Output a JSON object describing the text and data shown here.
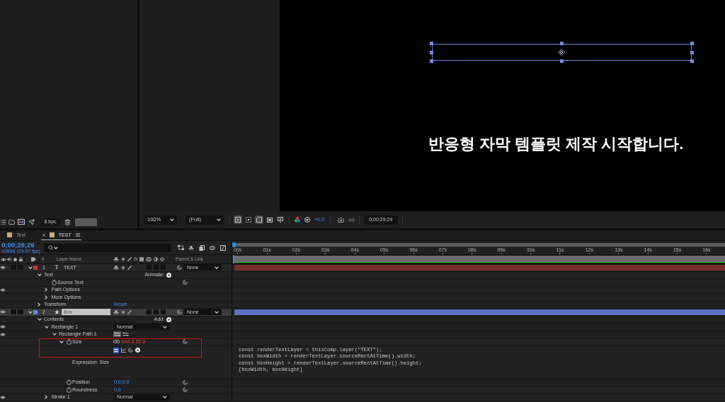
{
  "project_panel": {
    "bit_depth": "8 bpc"
  },
  "viewer": {
    "caption": "반응형 자막 템플릿 제작 시작합니다.",
    "zoom": "100%",
    "resolution": "(Full)",
    "toggles": [
      {
        "kind": "cursor",
        "on": true
      },
      {
        "kind": "grid",
        "on": false
      },
      {
        "kind": "corner",
        "on": true
      },
      {
        "kind": "frame",
        "on": false
      },
      {
        "kind": "screen",
        "on": false
      }
    ],
    "exposure": "+0.0",
    "timecode": "0;00;29;29"
  },
  "timeline": {
    "tabs": [
      {
        "label": "Text",
        "selected": false
      },
      {
        "label": "TEST",
        "selected": true
      }
    ],
    "timecode": "0;00;29;29",
    "frame_info": "00899 (29.97 fps)",
    "columns": {
      "number": "#",
      "layer_name": "Layer Name",
      "effects": "fx",
      "parent": "Parent & Link"
    },
    "ruler": [
      "00s",
      "01s",
      "02s",
      "03s",
      "04s",
      "05s",
      "06s",
      "07s",
      "08s",
      "09s",
      "10s",
      "11s",
      "12s",
      "13s",
      "14s",
      "15s",
      "16s"
    ],
    "layers": [
      {
        "number": "1",
        "kind": "text",
        "type_icon": "T",
        "name": "TEXT",
        "color": "#c23a32",
        "selected": false,
        "visible": true,
        "expanded": true,
        "parent": "None",
        "children": [
          {
            "kind": "group",
            "name": "Text",
            "expanded": true,
            "action": "Animate:",
            "children": [
              {
                "kind": "property",
                "name": "Source Text"
              },
              {
                "kind": "group",
                "name": "Path Options",
                "expanded": false,
                "visible": true
              },
              {
                "kind": "group",
                "name": "More Options",
                "expanded": false
              }
            ]
          },
          {
            "kind": "group",
            "name": "Transform",
            "expanded": false,
            "link": "Reset"
          }
        ]
      },
      {
        "number": "2",
        "kind": "shape",
        "name": "Box",
        "color": "#6f82ea",
        "selected": true,
        "visible": true,
        "expanded": true,
        "parent": "None",
        "children": [
          {
            "kind": "group",
            "name": "Contents",
            "expanded": true,
            "action": "Add:",
            "children": [
              {
                "kind": "group",
                "name": "Rectangle 1",
                "expanded": true,
                "visible": true,
                "blend": "Normal",
                "children": [
                  {
                    "kind": "group",
                    "name": "Rectangle Path 1",
                    "expanded": true,
                    "visible": true,
                    "direction": [
                      {
                        "selected": true
                      },
                      {
                        "selected": false
                      }
                    ],
                    "children": [
                      {
                        "kind": "property",
                        "name": "Size",
                        "expanded": true,
                        "linked": true,
                        "value": "884.8,55.8",
                        "highlighted": true,
                        "children": [
                          {
                            "kind": "expression",
                            "label": "Expression: Size",
                            "enabled": true,
                            "code": [
                              "const renderTextLayer = thisComp.layer(\"TEXT\");",
                              "const boxWidth = renderTextLayer.sourceRectAtTime().width;",
                              "const boxHeight = renderTextLayer.sourceRectAtTime().height;",
                              "[boxWidth, boxHeight]"
                            ]
                          }
                        ]
                      },
                      {
                        "kind": "property",
                        "name": "Position",
                        "value": "0.0,0.0"
                      },
                      {
                        "kind": "property",
                        "name": "Roundness",
                        "value": "0.0"
                      }
                    ]
                  }
                ]
              },
              {
                "kind": "group",
                "name": "Stroke 1",
                "expanded": false,
                "visible": true,
                "blend": "Normal"
              }
            ]
          }
        ]
      }
    ]
  }
}
